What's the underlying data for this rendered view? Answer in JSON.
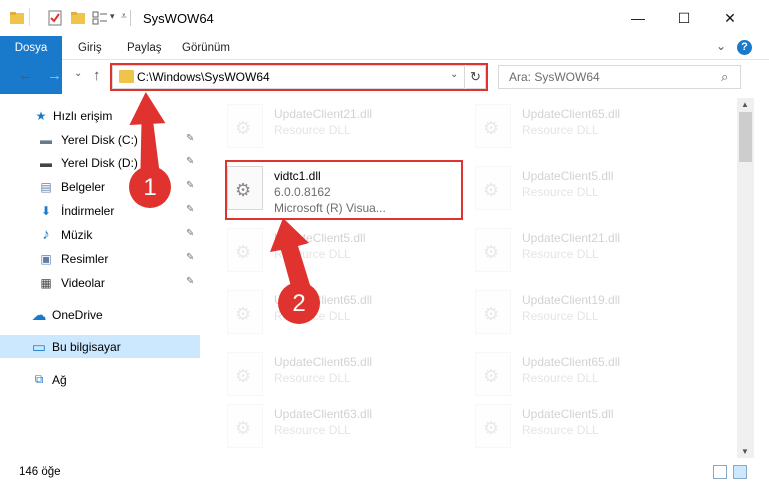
{
  "window": {
    "title": "SysWOW64",
    "minimize_glyph": "—",
    "maximize_glyph": "☐",
    "close_glyph": "✕"
  },
  "ribbon": {
    "tabs": [
      "Dosya",
      "Giriş",
      "Paylaş",
      "Görünüm"
    ],
    "expand_glyph": "⌄",
    "help_glyph": "?"
  },
  "navigation": {
    "back_glyph": "←",
    "forward_glyph": "→",
    "recent_glyph": "⌄",
    "up_glyph": "↑",
    "address": "C:\\Windows\\SysWOW64",
    "address_dropdown_glyph": "⌄",
    "refresh_glyph": "↻",
    "search_placeholder": "Ara: SysWOW64",
    "search_glyph": "⌕"
  },
  "sidebar": {
    "items": [
      {
        "label": "Hızlı erişim",
        "icon": "star-icon",
        "glyph": "★",
        "color": "#1979ca",
        "pinned": false
      },
      {
        "label": "Yerel Disk (C:)",
        "icon": "drive-icon",
        "glyph": "▬",
        "color": "#6a7a8a",
        "pinned": true
      },
      {
        "label": "Yerel Disk (D:)",
        "icon": "drive-icon",
        "glyph": "▬",
        "color": "#444444",
        "pinned": true
      },
      {
        "label": "Belgeler",
        "icon": "documents-icon",
        "glyph": "▤",
        "color": "#5f7fa8",
        "pinned": true
      },
      {
        "label": "İndirmeler",
        "icon": "downloads-icon",
        "glyph": "⬇",
        "color": "#1979ca",
        "pinned": true
      },
      {
        "label": "Müzik",
        "icon": "music-icon",
        "glyph": "♪",
        "color": "#1979ca",
        "pinned": true
      },
      {
        "label": "Resimler",
        "icon": "pictures-icon",
        "glyph": "▣",
        "color": "#5f7fa8",
        "pinned": true
      },
      {
        "label": "Videolar",
        "icon": "videos-icon",
        "glyph": "▦",
        "color": "#444444",
        "pinned": true
      },
      {
        "label": "OneDrive",
        "icon": "cloud-icon",
        "glyph": "☁",
        "color": "#1979ca",
        "pinned": false
      },
      {
        "label": "Bu bilgisayar",
        "icon": "computer-icon",
        "glyph": "▭",
        "color": "#1979ca",
        "pinned": false
      },
      {
        "label": "Ağ",
        "icon": "network-icon",
        "glyph": "⧉",
        "color": "#1979ca",
        "pinned": false
      }
    ],
    "pin_glyph": "📌"
  },
  "files": {
    "left": [
      {
        "name": "UpdateClient21.dll",
        "sub1": "Resource DLL",
        "sub2": "",
        "faded": true
      },
      {
        "name": "vidtc1.dll",
        "sub1": "6.0.0.8162",
        "sub2": "Microsoft (R) Visua...",
        "faded": false
      },
      {
        "name": "UpdateClient5.dll",
        "sub1": "Resource DLL",
        "sub2": "",
        "faded": true
      },
      {
        "name": "UpdateClient65.dll",
        "sub1": "Resource DLL",
        "sub2": "",
        "faded": true
      },
      {
        "name": "UpdateClient65.dll",
        "sub1": "Resource DLL",
        "sub2": "",
        "faded": true
      },
      {
        "name": "UpdateClient63.dll",
        "sub1": "Resource DLL",
        "sub2": "",
        "faded": true
      }
    ],
    "right": [
      {
        "name": "UpdateClient65.dll",
        "sub1": "Resource DLL",
        "faded": true
      },
      {
        "name": "UpdateClient5.dll",
        "sub1": "Resource DLL",
        "faded": true
      },
      {
        "name": "UpdateClient21.dll",
        "sub1": "Resource DLL",
        "faded": true
      },
      {
        "name": "UpdateClient19.dll",
        "sub1": "Resource DLL",
        "faded": true
      },
      {
        "name": "UpdateClient65.dll",
        "sub1": "Resource DLL",
        "faded": true
      },
      {
        "name": "UpdateClient5.dll",
        "sub1": "Resource DLL",
        "faded": true
      }
    ]
  },
  "status": {
    "count": "146 öğe"
  },
  "annotations": {
    "step1": "1",
    "step2": "2",
    "color": "#e0332f"
  }
}
